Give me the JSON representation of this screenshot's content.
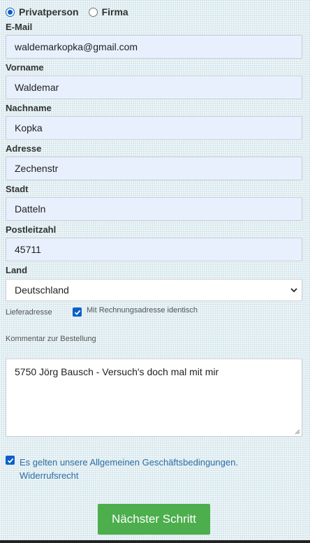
{
  "customer_type": {
    "options": [
      {
        "label": "Privatperson",
        "selected": true
      },
      {
        "label": "Firma",
        "selected": false
      }
    ]
  },
  "form": {
    "email": {
      "label": "E-Mail",
      "value": "waldemarkopka@gmail.com"
    },
    "firstname": {
      "label": "Vorname",
      "value": "Waldemar"
    },
    "lastname": {
      "label": "Nachname",
      "value": "Kopka"
    },
    "address": {
      "label": "Adresse",
      "value": "Zechenstr"
    },
    "city": {
      "label": "Stadt",
      "value": "Datteln"
    },
    "zip": {
      "label": "Postleitzahl",
      "value": "45711"
    },
    "country": {
      "label": "Land",
      "value": "Deutschland"
    }
  },
  "delivery": {
    "label": "Lieferadresse",
    "same_as_billing": {
      "label": "Mit Rechnungsadresse identisch",
      "checked": true
    }
  },
  "comment": {
    "label": "Kommentar zur Bestellung",
    "value": "5750 Jörg Bausch - Versuch's doch mal mit mir"
  },
  "terms": {
    "checked": true,
    "text": "Es gelten unsere Allgemeinen Geschäftsbedingungen.",
    "withdrawal_link": "Widerrufsrecht"
  },
  "next_button": {
    "label": "Nächster Schritt"
  },
  "colors": {
    "accent": "#0a5fc9",
    "button": "#4cae4c",
    "link": "#2d6ea5",
    "input_bg": "#e8f0fe"
  }
}
